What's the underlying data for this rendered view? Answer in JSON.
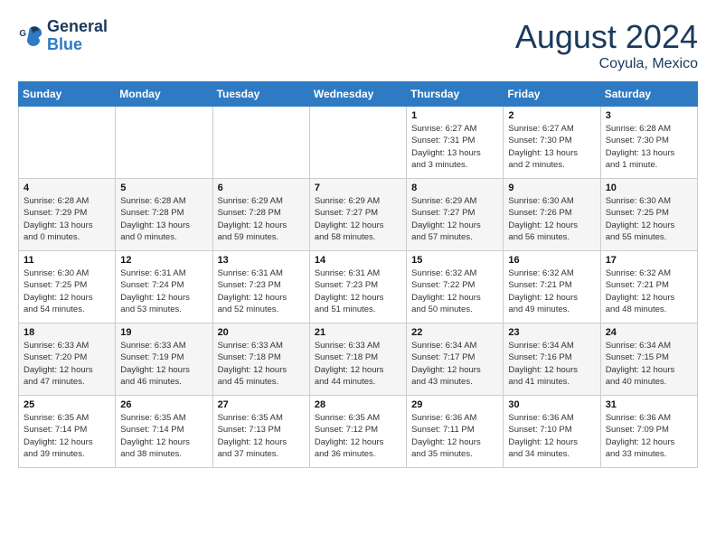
{
  "header": {
    "logo_general": "General",
    "logo_blue": "Blue",
    "month_year": "August 2024",
    "location": "Coyula, Mexico"
  },
  "weekdays": [
    "Sunday",
    "Monday",
    "Tuesday",
    "Wednesday",
    "Thursday",
    "Friday",
    "Saturday"
  ],
  "weeks": [
    [
      {
        "day": "",
        "info": ""
      },
      {
        "day": "",
        "info": ""
      },
      {
        "day": "",
        "info": ""
      },
      {
        "day": "",
        "info": ""
      },
      {
        "day": "1",
        "info": "Sunrise: 6:27 AM\nSunset: 7:31 PM\nDaylight: 13 hours\nand 3 minutes."
      },
      {
        "day": "2",
        "info": "Sunrise: 6:27 AM\nSunset: 7:30 PM\nDaylight: 13 hours\nand 2 minutes."
      },
      {
        "day": "3",
        "info": "Sunrise: 6:28 AM\nSunset: 7:30 PM\nDaylight: 13 hours\nand 1 minute."
      }
    ],
    [
      {
        "day": "4",
        "info": "Sunrise: 6:28 AM\nSunset: 7:29 PM\nDaylight: 13 hours\nand 0 minutes."
      },
      {
        "day": "5",
        "info": "Sunrise: 6:28 AM\nSunset: 7:28 PM\nDaylight: 13 hours\nand 0 minutes."
      },
      {
        "day": "6",
        "info": "Sunrise: 6:29 AM\nSunset: 7:28 PM\nDaylight: 12 hours\nand 59 minutes."
      },
      {
        "day": "7",
        "info": "Sunrise: 6:29 AM\nSunset: 7:27 PM\nDaylight: 12 hours\nand 58 minutes."
      },
      {
        "day": "8",
        "info": "Sunrise: 6:29 AM\nSunset: 7:27 PM\nDaylight: 12 hours\nand 57 minutes."
      },
      {
        "day": "9",
        "info": "Sunrise: 6:30 AM\nSunset: 7:26 PM\nDaylight: 12 hours\nand 56 minutes."
      },
      {
        "day": "10",
        "info": "Sunrise: 6:30 AM\nSunset: 7:25 PM\nDaylight: 12 hours\nand 55 minutes."
      }
    ],
    [
      {
        "day": "11",
        "info": "Sunrise: 6:30 AM\nSunset: 7:25 PM\nDaylight: 12 hours\nand 54 minutes."
      },
      {
        "day": "12",
        "info": "Sunrise: 6:31 AM\nSunset: 7:24 PM\nDaylight: 12 hours\nand 53 minutes."
      },
      {
        "day": "13",
        "info": "Sunrise: 6:31 AM\nSunset: 7:23 PM\nDaylight: 12 hours\nand 52 minutes."
      },
      {
        "day": "14",
        "info": "Sunrise: 6:31 AM\nSunset: 7:23 PM\nDaylight: 12 hours\nand 51 minutes."
      },
      {
        "day": "15",
        "info": "Sunrise: 6:32 AM\nSunset: 7:22 PM\nDaylight: 12 hours\nand 50 minutes."
      },
      {
        "day": "16",
        "info": "Sunrise: 6:32 AM\nSunset: 7:21 PM\nDaylight: 12 hours\nand 49 minutes."
      },
      {
        "day": "17",
        "info": "Sunrise: 6:32 AM\nSunset: 7:21 PM\nDaylight: 12 hours\nand 48 minutes."
      }
    ],
    [
      {
        "day": "18",
        "info": "Sunrise: 6:33 AM\nSunset: 7:20 PM\nDaylight: 12 hours\nand 47 minutes."
      },
      {
        "day": "19",
        "info": "Sunrise: 6:33 AM\nSunset: 7:19 PM\nDaylight: 12 hours\nand 46 minutes."
      },
      {
        "day": "20",
        "info": "Sunrise: 6:33 AM\nSunset: 7:18 PM\nDaylight: 12 hours\nand 45 minutes."
      },
      {
        "day": "21",
        "info": "Sunrise: 6:33 AM\nSunset: 7:18 PM\nDaylight: 12 hours\nand 44 minutes."
      },
      {
        "day": "22",
        "info": "Sunrise: 6:34 AM\nSunset: 7:17 PM\nDaylight: 12 hours\nand 43 minutes."
      },
      {
        "day": "23",
        "info": "Sunrise: 6:34 AM\nSunset: 7:16 PM\nDaylight: 12 hours\nand 41 minutes."
      },
      {
        "day": "24",
        "info": "Sunrise: 6:34 AM\nSunset: 7:15 PM\nDaylight: 12 hours\nand 40 minutes."
      }
    ],
    [
      {
        "day": "25",
        "info": "Sunrise: 6:35 AM\nSunset: 7:14 PM\nDaylight: 12 hours\nand 39 minutes."
      },
      {
        "day": "26",
        "info": "Sunrise: 6:35 AM\nSunset: 7:14 PM\nDaylight: 12 hours\nand 38 minutes."
      },
      {
        "day": "27",
        "info": "Sunrise: 6:35 AM\nSunset: 7:13 PM\nDaylight: 12 hours\nand 37 minutes."
      },
      {
        "day": "28",
        "info": "Sunrise: 6:35 AM\nSunset: 7:12 PM\nDaylight: 12 hours\nand 36 minutes."
      },
      {
        "day": "29",
        "info": "Sunrise: 6:36 AM\nSunset: 7:11 PM\nDaylight: 12 hours\nand 35 minutes."
      },
      {
        "day": "30",
        "info": "Sunrise: 6:36 AM\nSunset: 7:10 PM\nDaylight: 12 hours\nand 34 minutes."
      },
      {
        "day": "31",
        "info": "Sunrise: 6:36 AM\nSunset: 7:09 PM\nDaylight: 12 hours\nand 33 minutes."
      }
    ]
  ]
}
